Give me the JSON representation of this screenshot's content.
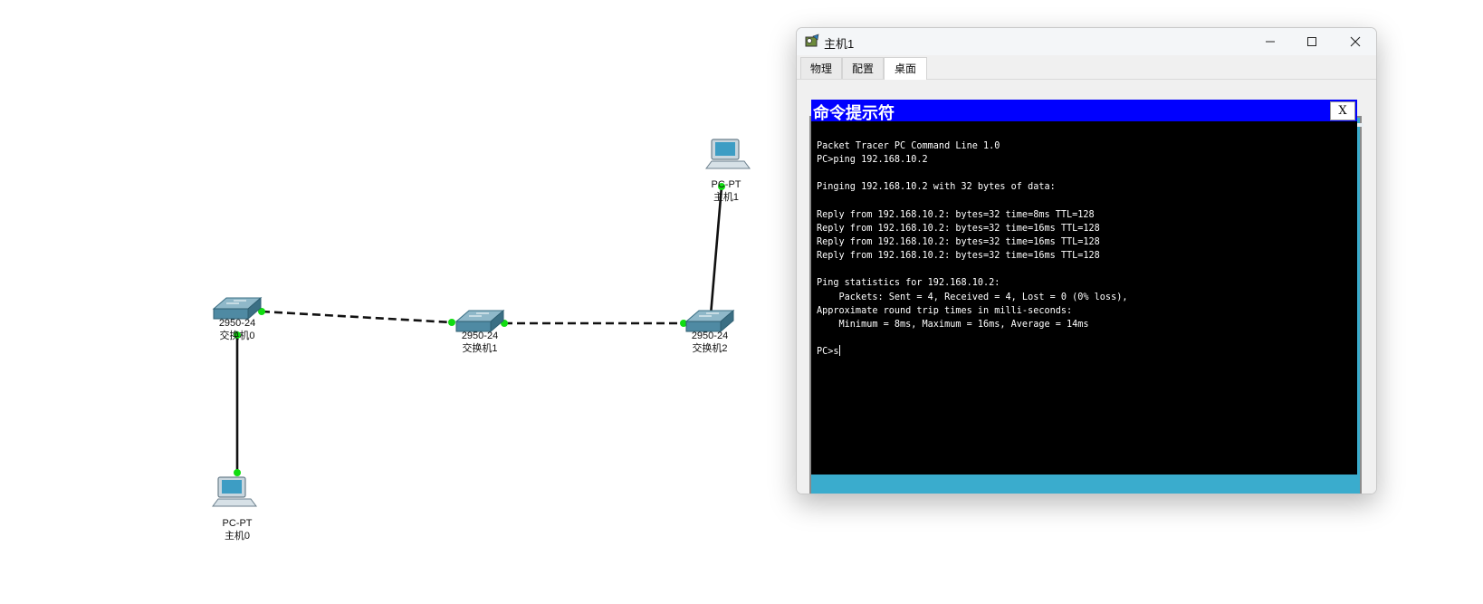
{
  "topology": {
    "devices": [
      {
        "id": "switch0",
        "model": "2950-24",
        "name": "交换机0",
        "icon": "switch-icon"
      },
      {
        "id": "switch1",
        "model": "2950-24",
        "name": "交换机1",
        "icon": "switch-icon"
      },
      {
        "id": "switch2",
        "model": "2950-24",
        "name": "交换机2",
        "icon": "switch-icon"
      },
      {
        "id": "pc0",
        "model": "PC-PT",
        "name": "主机0",
        "icon": "pc-icon"
      },
      {
        "id": "pc1",
        "model": "PC-PT",
        "name": "主机1",
        "icon": "pc-icon"
      }
    ],
    "links": [
      {
        "from": "switch0",
        "to": "switch1",
        "cable": "crossover"
      },
      {
        "from": "switch1",
        "to": "switch2",
        "cable": "crossover"
      },
      {
        "from": "switch0",
        "to": "pc0",
        "cable": "straight-through"
      },
      {
        "from": "switch2",
        "to": "pc1",
        "cable": "straight-through"
      }
    ],
    "link_up_color": "#11dd11"
  },
  "window": {
    "title": "主机1",
    "tabs": [
      {
        "label": "物理",
        "active": false
      },
      {
        "label": "配置",
        "active": false
      },
      {
        "label": "桌面",
        "active": true
      }
    ]
  },
  "desktop": {
    "background_color": "#3aaccd",
    "command_prompt": {
      "title": "命令提示符",
      "close_label": "X",
      "title_color": "#0000ff",
      "lines": [
        "Packet Tracer PC Command Line 1.0",
        "PC>ping 192.168.10.2",
        "",
        "Pinging 192.168.10.2 with 32 bytes of data:",
        "",
        "Reply from 192.168.10.2: bytes=32 time=8ms TTL=128",
        "Reply from 192.168.10.2: bytes=32 time=16ms TTL=128",
        "Reply from 192.168.10.2: bytes=32 time=16ms TTL=128",
        "Reply from 192.168.10.2: bytes=32 time=16ms TTL=128",
        "",
        "Ping statistics for 192.168.10.2:",
        "    Packets: Sent = 4, Received = 4, Lost = 0 (0% loss),",
        "Approximate round trip times in milli-seconds:",
        "    Minimum = 8ms, Maximum = 16ms, Average = 14ms",
        "",
        "PC>s"
      ]
    }
  }
}
